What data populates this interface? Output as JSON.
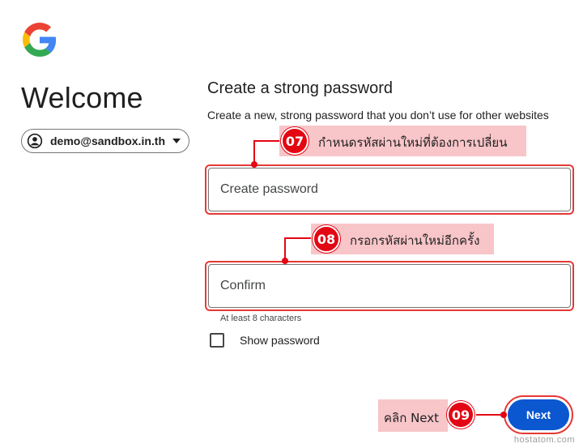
{
  "logo": {
    "name": "google-logo"
  },
  "left": {
    "heading": "Welcome",
    "account_email": "demo@sandbox.in.th"
  },
  "main": {
    "title": "Create a strong password",
    "subtitle": "Create a new, strong password that you don’t use for other websites",
    "create_placeholder": "Create password",
    "confirm_placeholder": "Confirm",
    "hint": "At least 8 characters",
    "show_password_label": "Show password",
    "next_label": "Next"
  },
  "annotations": {
    "step07": {
      "number": "07",
      "text": "กำหนดรหัสผ่านใหม่ที่ต้องการเปลี่ยน"
    },
    "step08": {
      "number": "08",
      "text": "กรอกรหัสผ่านใหม่อีกครั้ง"
    },
    "step09": {
      "number": "09",
      "text": "คลิก Next"
    }
  },
  "watermark": "hostatom.com",
  "colors": {
    "annotation_red": "#e30613",
    "annotation_fill": "#f8c5c9",
    "primary_button": "#0b57d0"
  }
}
